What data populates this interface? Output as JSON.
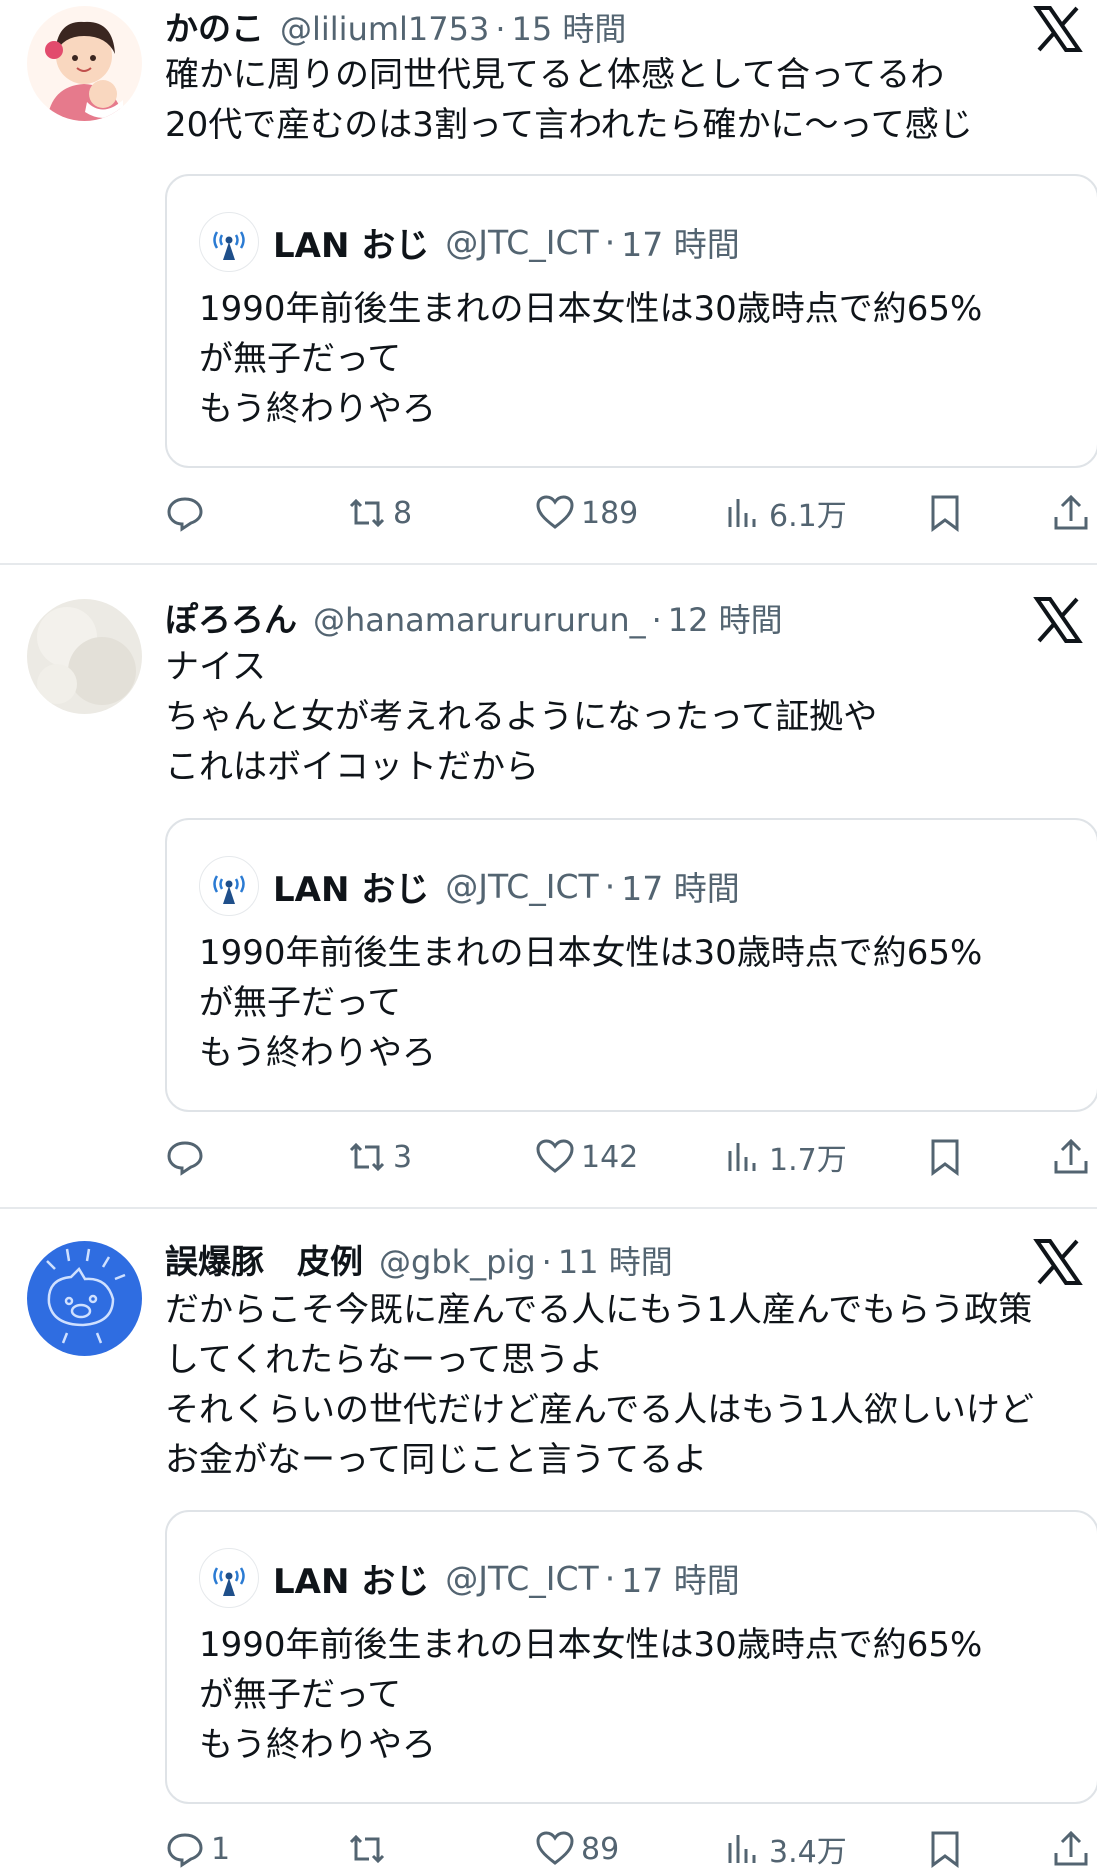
{
  "quoted_tweet": {
    "display_name": "LAN おじ",
    "handle": "@JTC_ICT",
    "time": "17 時間",
    "lines": [
      "1990年前後生まれの日本女性は30歳時点で約65%",
      "が無子だって",
      "もう終わりやろ"
    ]
  },
  "separator": "·",
  "tweets": [
    {
      "display_name": "かのこ",
      "handle": "@liliuml1753",
      "time": "15 時間",
      "lines": [
        "確かに周りの同世代見てると体感として合ってるわ",
        "20代で産むのは3割って言われたら確かに〜って感じ"
      ],
      "reply_count": "",
      "retweet_count": "8",
      "like_count": "189",
      "view_count": "6.1万"
    },
    {
      "display_name": "ぽろろん",
      "handle": "@hanamarurururun_",
      "time": "12 時間",
      "lines": [
        "ナイス",
        "ちゃんと女が考えれるようになったって証拠や",
        "これはボイコットだから"
      ],
      "reply_count": "",
      "retweet_count": "3",
      "like_count": "142",
      "view_count": "1.7万"
    },
    {
      "display_name": "誤爆豚　皮例",
      "handle": "@gbk_pig",
      "time": "11 時間",
      "lines": [
        "だからこそ今既に産んでる人にもう1人産んでもらう政策",
        "してくれたらなーって思うよ",
        "それくらいの世代だけど産んでる人はもう1人欲しいけど",
        "お金がなーって同じこと言うてるよ"
      ],
      "reply_count": "1",
      "retweet_count": "",
      "like_count": "89",
      "view_count": "3.4万"
    }
  ],
  "colors": {
    "text": "#0f1419",
    "muted": "#536471",
    "border": "#dfe3e7",
    "avatar3": "#2f6de1"
  },
  "icons": [
    "reply-icon",
    "retweet-icon",
    "like-icon",
    "views-icon",
    "bookmark-icon",
    "share-icon",
    "x-logo-icon"
  ]
}
